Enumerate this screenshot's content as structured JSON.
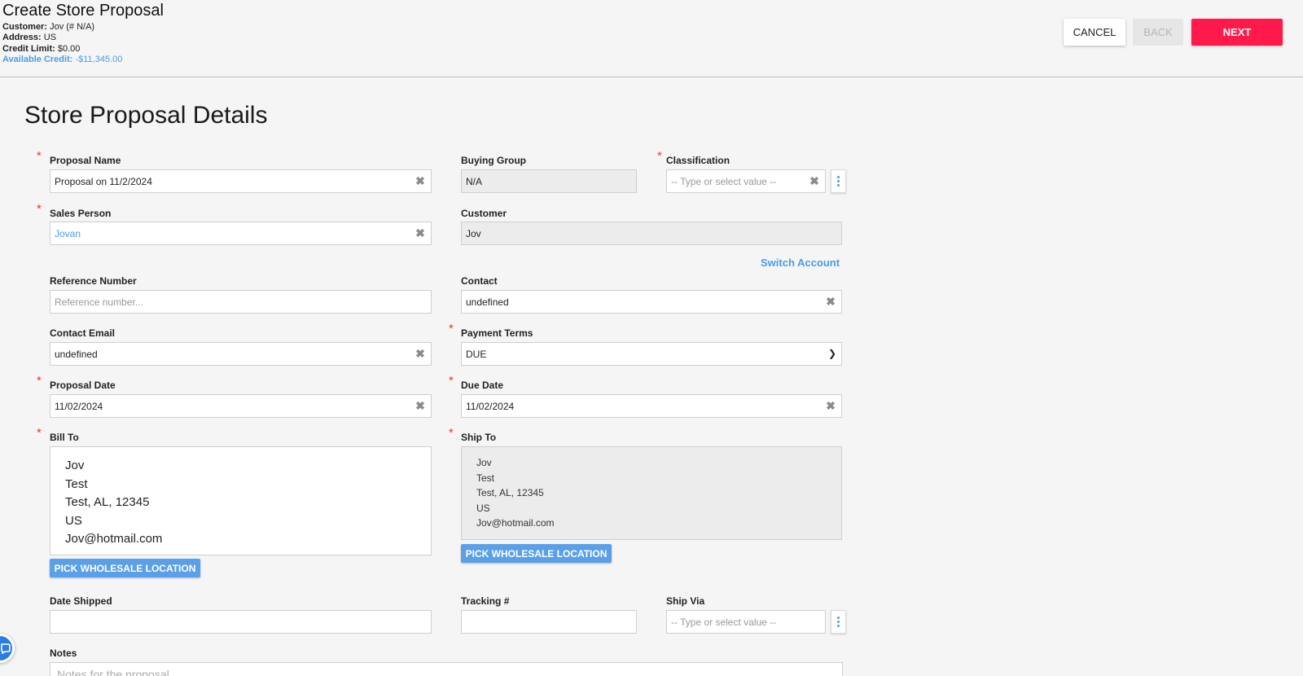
{
  "header": {
    "title": "Create Store Proposal",
    "customer_label": "Customer:",
    "customer_value": "Jov (# N/A)",
    "address_label": "Address:",
    "address_value": "US",
    "credit_limit_label": "Credit Limit:",
    "credit_limit_value": "$0.00",
    "available_credit_label": "Available Credit:",
    "available_credit_value": "-$11,345.00",
    "cancel_label": "CANCEL",
    "back_label": "BACK",
    "next_label": "NEXT"
  },
  "section_title": "Store Proposal Details",
  "form": {
    "proposal_name": {
      "label": "Proposal Name",
      "value": "Proposal on 11/2/2024"
    },
    "buying_group": {
      "label": "Buying Group",
      "value": "N/A"
    },
    "classification": {
      "label": "Classification",
      "placeholder": "-- Type or select value --"
    },
    "sales_person": {
      "label": "Sales Person",
      "value": "Jovan"
    },
    "customer": {
      "label": "Customer",
      "value": "Jov"
    },
    "switch_account": "Switch Account",
    "reference_number": {
      "label": "Reference Number",
      "placeholder": "Reference number..."
    },
    "contact": {
      "label": "Contact",
      "value": "undefined"
    },
    "contact_email": {
      "label": "Contact Email",
      "value": "undefined"
    },
    "payment_terms": {
      "label": "Payment Terms",
      "value": "DUE"
    },
    "proposal_date": {
      "label": "Proposal Date",
      "value": "11/02/2024"
    },
    "due_date": {
      "label": "Due Date",
      "value": "11/02/2024"
    },
    "bill_to": {
      "label": "Bill To",
      "lines": [
        "Jov",
        "Test",
        "Test, AL, 12345",
        "US",
        "Jov@hotmail.com"
      ],
      "button": "PICK WHOLESALE LOCATION"
    },
    "ship_to": {
      "label": "Ship To",
      "lines": [
        "Jov",
        "Test",
        "Test, AL, 12345",
        "US",
        "Jov@hotmail.com"
      ],
      "button": "PICK WHOLESALE LOCATION"
    },
    "date_shipped": {
      "label": "Date Shipped",
      "value": ""
    },
    "tracking": {
      "label": "Tracking #",
      "value": ""
    },
    "ship_via": {
      "label": "Ship Via",
      "placeholder": "-- Type or select value --"
    },
    "notes": {
      "label": "Notes",
      "placeholder": "Notes for the proposal..."
    }
  },
  "colors": {
    "accent": "#4a9de6",
    "next_button": "#ff1a4b",
    "required": "#e53935",
    "pick_button": "#5aa0e8"
  },
  "icons": {
    "clear": "x-icon",
    "more": "kebab-icon",
    "dropdown": "chevron-down-icon",
    "chat": "chat-icon"
  }
}
